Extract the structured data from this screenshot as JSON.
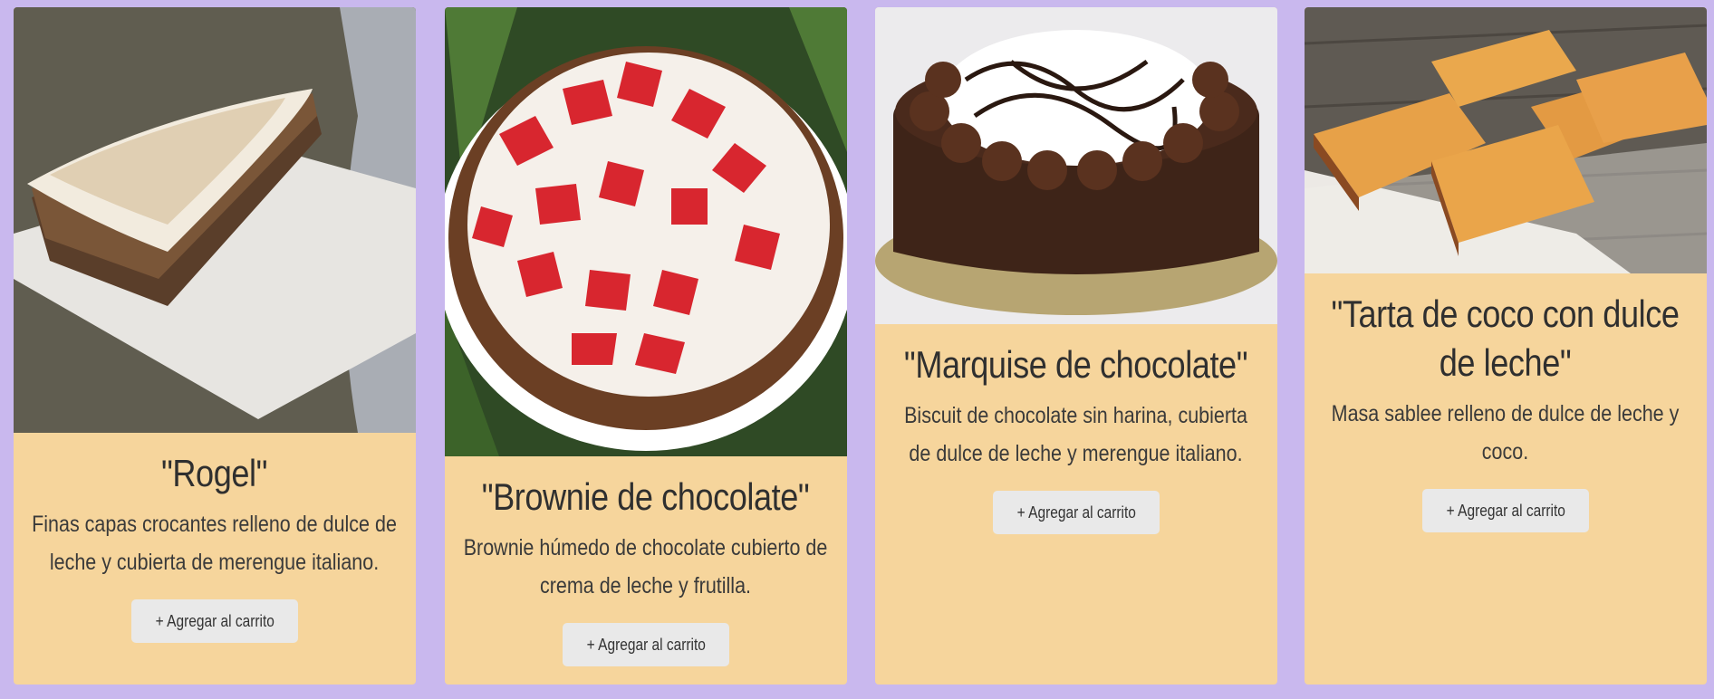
{
  "products": [
    {
      "title": "\"Rogel\"",
      "description": "Finas capas crocantes relleno de dulce de leche y cubierta de merengue italiano.",
      "button_label": "+ Agregar al carrito"
    },
    {
      "title": "\"Brownie de chocolate\"",
      "description": "Brownie húmedo de chocolate cubierto de crema de leche y frutilla.",
      "button_label": "+ Agregar al carrito"
    },
    {
      "title": "\"Marquise de chocolate\"",
      "description": "Biscuit de chocolate sin harina, cubierta de dulce de leche y merengue italiano.",
      "button_label": "+ Agregar al carrito"
    },
    {
      "title": "\"Tarta de coco con dulce de leche\"",
      "description": "Masa sablee relleno de dulce de leche y coco.",
      "button_label": "+ Agregar al carrito"
    }
  ],
  "colors": {
    "page_background": "#c9b8ee",
    "card_background": "#f6d59c",
    "button_background": "#e9e9e9",
    "text": "#2f2f2f"
  }
}
